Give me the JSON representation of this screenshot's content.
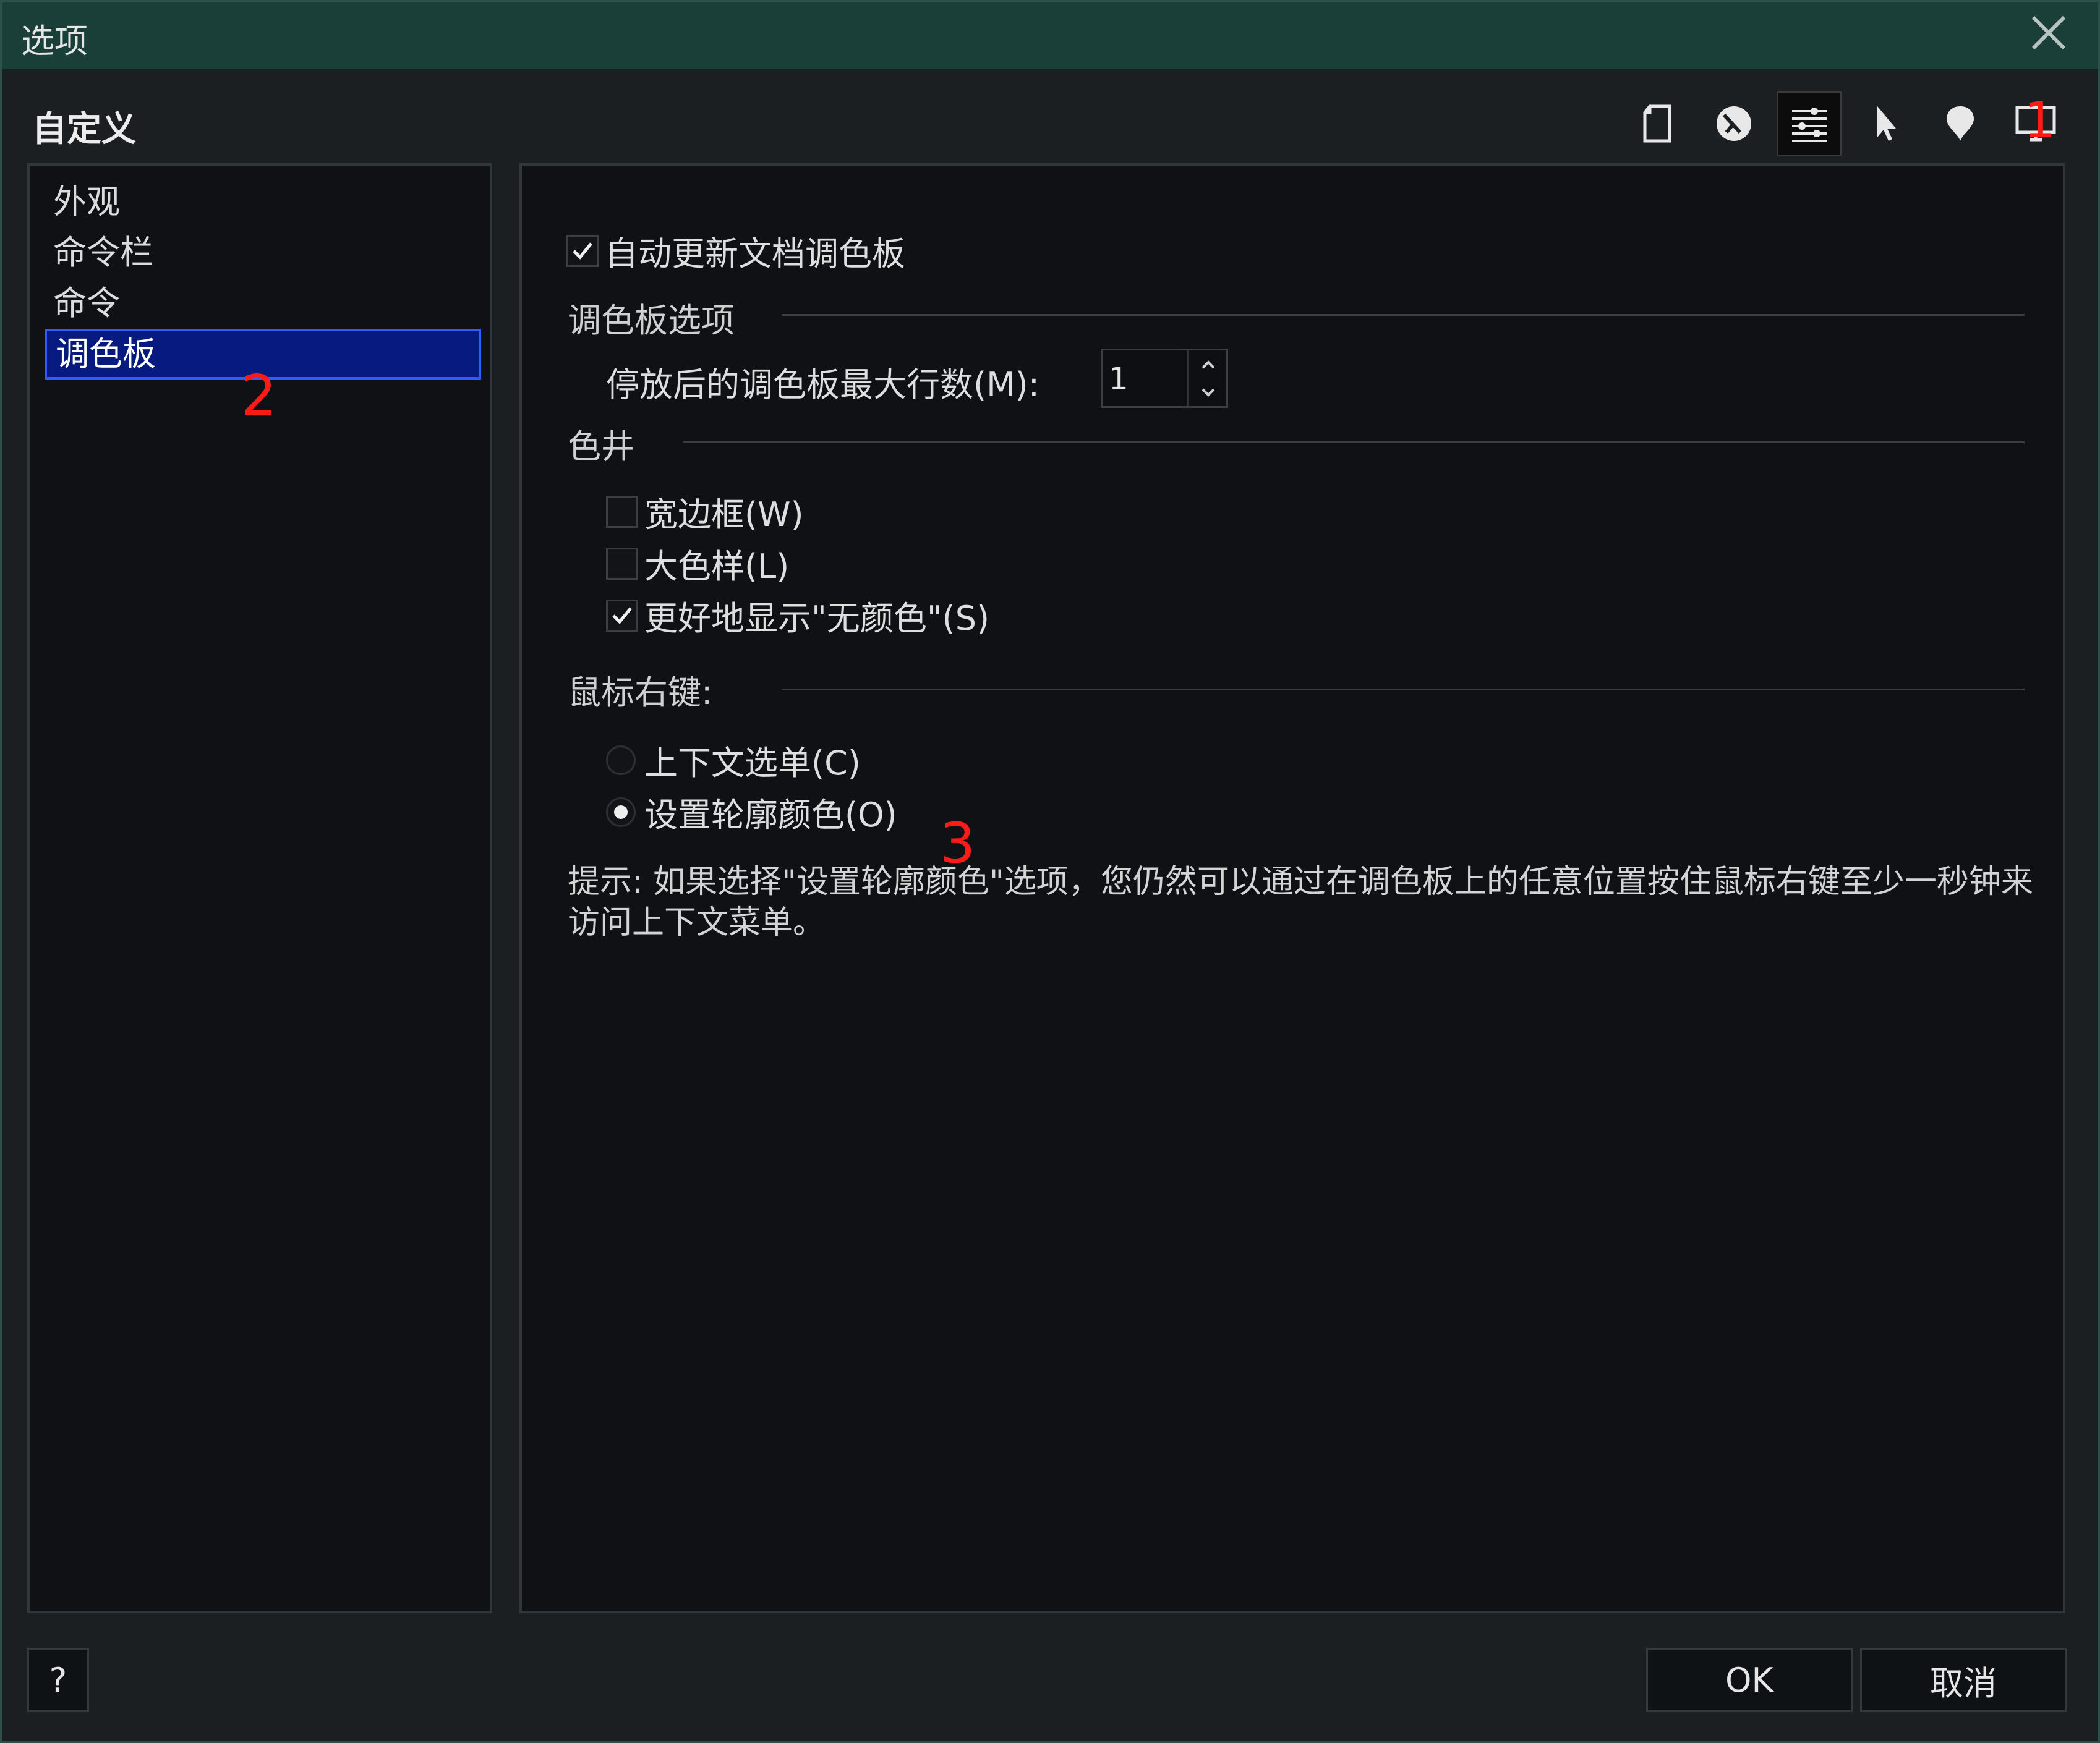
{
  "window": {
    "title": "选项"
  },
  "header": {
    "title": "自定义"
  },
  "toolbar": {
    "buttons": [
      {
        "icon": "document-icon",
        "active": false
      },
      {
        "icon": "workspace-globe-icon",
        "active": false
      },
      {
        "icon": "customize-sliders-icon",
        "active": true
      },
      {
        "icon": "pointer-tool-icon",
        "active": false
      },
      {
        "icon": "bulb-marker-icon",
        "active": false
      },
      {
        "icon": "monitor-icon",
        "active": false
      }
    ]
  },
  "sidebar": {
    "items": [
      {
        "label": "外观",
        "selected": false
      },
      {
        "label": "命令栏",
        "selected": false
      },
      {
        "label": "命令",
        "selected": false
      },
      {
        "label": "调色板",
        "selected": true
      }
    ]
  },
  "main": {
    "auto_update": {
      "label": "自动更新文档调色板",
      "checked": true
    },
    "palette_options": {
      "title": "调色板选项",
      "max_rows_label": "停放后的调色板最大行数(M):",
      "max_rows_value": "1"
    },
    "color_wells": {
      "title": "色井",
      "wide_border": {
        "label": "宽边框(W)",
        "checked": false
      },
      "large_swatch": {
        "label": "大色样(L)",
        "checked": false
      },
      "better_no_color": {
        "label": "更好地显示\"无颜色\"(S)",
        "checked": true
      }
    },
    "right_click": {
      "title": "鼠标右键:",
      "context_menu": {
        "label": "上下文选单(C)",
        "selected": false
      },
      "set_outline": {
        "label": "设置轮廓颜色(O)",
        "selected": true
      }
    },
    "hint": "提示: 如果选择\"设置轮廓颜色\"选项，您仍然可以通过在调色板上的任意位置按住鼠标右键至少一秒钟来访问上下文菜单。"
  },
  "annotations": {
    "a1": "1",
    "a2": "2",
    "a3": "3"
  },
  "footer": {
    "help_label": "?",
    "ok_label": "OK",
    "cancel_label": "取消"
  },
  "colors": {
    "accent_selection": "#071a80",
    "annotation": "#ff1a1a",
    "titlebar": "#1a3f39"
  }
}
